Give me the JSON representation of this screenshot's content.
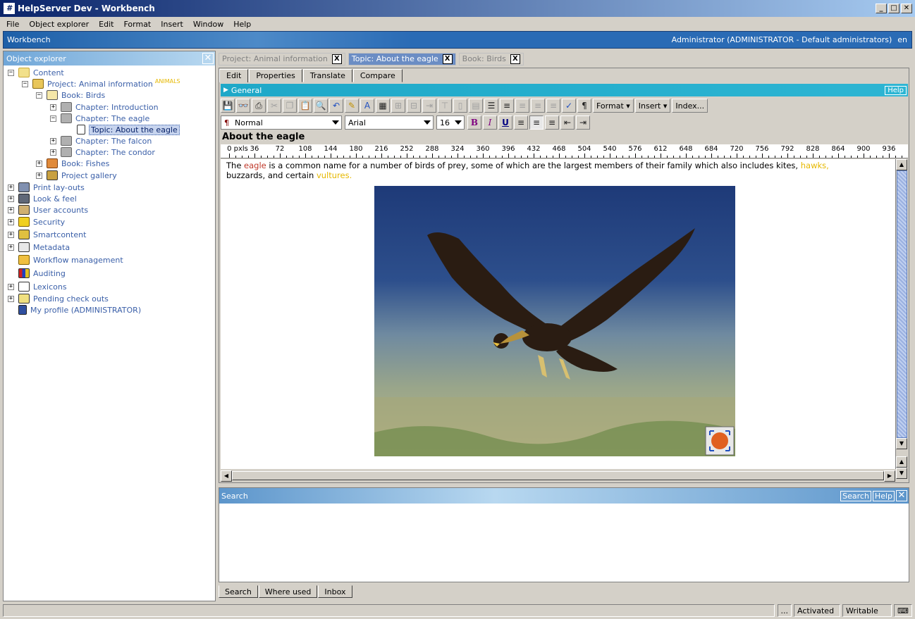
{
  "window": {
    "title": "HelpServer Dev - Workbench",
    "app_icon": "#"
  },
  "menu": [
    "File",
    "Object explorer",
    "Edit",
    "Format",
    "Insert",
    "Window",
    "Help"
  ],
  "workbench_bar": {
    "title": "Workbench",
    "user": "Administrator (ADMINISTRATOR - Default administrators)",
    "lang": "en"
  },
  "explorer": {
    "title": "Object explorer",
    "nodes": [
      {
        "label": "Content",
        "icon": "folder-icon"
      },
      {
        "label": "Project: Animal information",
        "badge": "ANIMALS",
        "icon": "project-icon"
      },
      {
        "label": "Book: Birds",
        "icon": "book-icon"
      },
      {
        "label": "Chapter: Introduction",
        "icon": "chapter-icon"
      },
      {
        "label": "Chapter: The eagle",
        "icon": "chapter-icon"
      },
      {
        "label": "Topic: About the eagle",
        "icon": "topic-icon"
      },
      {
        "label": "Chapter: The falcon",
        "icon": "chapter-icon"
      },
      {
        "label": "Chapter: The condor",
        "icon": "chapter-icon"
      },
      {
        "label": "Book: Fishes",
        "icon": "book-icon"
      },
      {
        "label": "Project gallery",
        "icon": "gallery-icon"
      },
      {
        "label": "Print lay-outs",
        "icon": "printer-icon"
      },
      {
        "label": "Look & feel",
        "icon": "monitor-icon"
      },
      {
        "label": "User accounts",
        "icon": "users-icon"
      },
      {
        "label": "Security",
        "icon": "lock-icon"
      },
      {
        "label": "Smartcontent",
        "icon": "smartcontent-icon"
      },
      {
        "label": "Metadata",
        "icon": "metadata-icon"
      },
      {
        "label": "Workflow management",
        "icon": "workflow-icon"
      },
      {
        "label": "Auditing",
        "icon": "chart-icon"
      },
      {
        "label": "Lexicons",
        "icon": "spellcheck-icon"
      },
      {
        "label": "Pending check outs",
        "icon": "checkout-icon"
      },
      {
        "label": "My profile (ADMINISTRATOR)",
        "icon": "user-icon"
      }
    ]
  },
  "doc_tabs": [
    {
      "label": "Project: Animal information",
      "close": "X"
    },
    {
      "label": "Topic: About the eagle",
      "close": "X"
    },
    {
      "label": "Book: Birds",
      "close": "X"
    }
  ],
  "sub_tabs": [
    "Edit",
    "Properties",
    "Translate",
    "Compare"
  ],
  "general_bar": {
    "title": "General",
    "help": "Help"
  },
  "toolbar": {
    "format": "Format",
    "insert": "Insert",
    "index": "Index..."
  },
  "format_bar": {
    "style": "Normal",
    "font": "Arial",
    "size": "16"
  },
  "doc_title": "About the eagle",
  "ruler": {
    "unit": "0 pxls",
    "marks": [
      "36",
      "72",
      "108",
      "144",
      "180",
      "216",
      "252",
      "288",
      "324",
      "360",
      "396",
      "432",
      "468",
      "504",
      "540",
      "576",
      "612",
      "648",
      "684",
      "720",
      "756",
      "792",
      "828",
      "864",
      "900",
      "936"
    ]
  },
  "body": {
    "p1": "The ",
    "k1": "eagle",
    "p2": " is a common name for a number of birds of prey, some of which are the largest members of their family which also includes kites, ",
    "k2": "hawks,",
    "p3": " buzzards, and certain ",
    "k3": "vultures."
  },
  "search_panel": {
    "title": "Search",
    "search_btn": "Search",
    "help_btn": "Help"
  },
  "bottom_tabs": [
    "Search",
    "Where used",
    "Inbox"
  ],
  "status": {
    "dots": "...",
    "activated": "Activated",
    "writable": "Writable"
  }
}
